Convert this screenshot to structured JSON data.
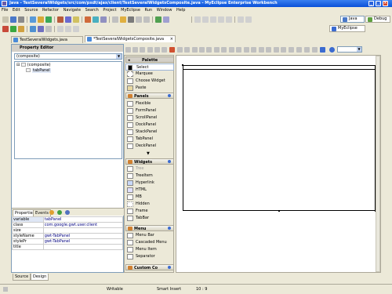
{
  "window": {
    "title": "Java - TestSeveralWidgets/src/com/pxdt/ajax/client/TestSeveralWidgetsComposite.java - MyEclipse Enterprise Workbench"
  },
  "menu": [
    "File",
    "Edit",
    "Source",
    "Refactor",
    "Navigate",
    "Search",
    "Project",
    "MyEclipse",
    "Run",
    "Window",
    "Help"
  ],
  "perspectives": {
    "java": "Java",
    "debug": "Debug",
    "myeclipse": "MyEclipse"
  },
  "editor_tabs": [
    {
      "label": "TestSeveralWidgets.java"
    },
    {
      "label": "*TestSeveralWidgetsComposite.java"
    }
  ],
  "property_editor": {
    "title": "Property Editor",
    "combo_value": "(composite)",
    "tree": [
      {
        "label": "(composite)"
      },
      {
        "label": "tabPanel"
      }
    ],
    "tabs": {
      "properties": "Properties",
      "events": "Events"
    },
    "rows": [
      {
        "key": "variable",
        "value": "tabPanel"
      },
      {
        "key": "class",
        "value": "com.google.gwt.user.client"
      },
      {
        "key": "size",
        "value": ""
      },
      {
        "key": "styleName",
        "value": "gwt-TabPanel"
      },
      {
        "key": "stylePr",
        "value": "gwt-TabPanel"
      },
      {
        "key": "title",
        "value": ""
      }
    ]
  },
  "palette": {
    "title": "Palette",
    "top_items": [
      "Select",
      "Marquee",
      "Choose Widget",
      "Paste"
    ],
    "categories": {
      "panels": {
        "label": "Panels",
        "items": [
          "Flexible",
          "FormPanel",
          "ScrollPanel",
          "DockPanel",
          "StackPanel",
          "TabPanel",
          "DeckPanel"
        ]
      },
      "widgets": {
        "label": "Widgets",
        "items": [
          "Tree",
          "TreeItem",
          "Hyperlink",
          "HTML",
          "MB",
          "Hidden",
          "Frame",
          "TabBar"
        ]
      },
      "menu": {
        "label": "Menu",
        "items": [
          "Menu Bar",
          "Cascaded Menu",
          "Menu Item",
          "Separator"
        ]
      },
      "custom": {
        "label": "Custom Co"
      }
    }
  },
  "bottom_tabs": {
    "source": "Source",
    "design": "Design"
  },
  "status": {
    "writable": "Writable",
    "insert_mode": "Smart Insert",
    "position": "10 : 9"
  },
  "colors": {
    "titlebar": "#0a50d8",
    "selection": "#dfe7f5",
    "accent": "#3b6bd0"
  }
}
